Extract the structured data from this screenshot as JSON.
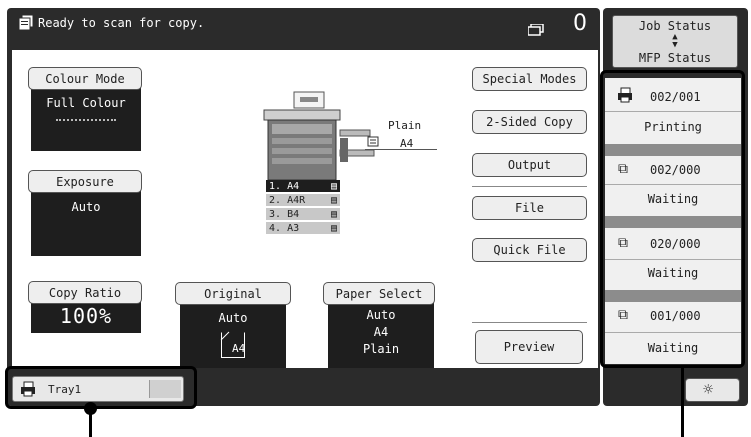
{
  "status": {
    "message": "Ready to scan for copy.",
    "copies": "0"
  },
  "left_keys": {
    "colour_mode": {
      "label": "Colour Mode",
      "value": "Full Colour"
    },
    "exposure": {
      "label": "Exposure",
      "value": "Auto"
    },
    "copy_ratio": {
      "label": "Copy Ratio",
      "value": "100%"
    }
  },
  "bottom_keys": {
    "original": {
      "label": "Original",
      "value": "Auto",
      "size": "A4"
    },
    "paper_select": {
      "label": "Paper Select",
      "value": "Auto",
      "size": "A4",
      "type": "Plain"
    }
  },
  "machine": {
    "output_type": "Plain",
    "output_size": "A4",
    "trays": [
      {
        "num": "1.",
        "size": "A4"
      },
      {
        "num": "2.",
        "size": "A4R"
      },
      {
        "num": "3.",
        "size": "B4"
      },
      {
        "num": "4.",
        "size": "A3"
      }
    ]
  },
  "right_keys": {
    "special_modes": "Special Modes",
    "two_sided_copy": "2-Sided Copy",
    "output": "Output",
    "file": "File",
    "quick_file": "Quick File",
    "preview": "Preview"
  },
  "job_panel": {
    "job_status": "Job Status",
    "mfp_status": "MFP Status",
    "jobs": [
      {
        "count": "002/001",
        "state": "Printing"
      },
      {
        "count": "002/000",
        "state": "Waiting"
      },
      {
        "count": "020/000",
        "state": "Waiting"
      },
      {
        "count": "001/000",
        "state": "Waiting"
      }
    ]
  },
  "tray_bar": {
    "label": "Tray1"
  },
  "icons": [
    "copy-icon",
    "job-queue-icon",
    "printer-icon",
    "copy-job-icon",
    "sun-icon",
    "updown-arrow-icon",
    "copier-machine-icon"
  ]
}
